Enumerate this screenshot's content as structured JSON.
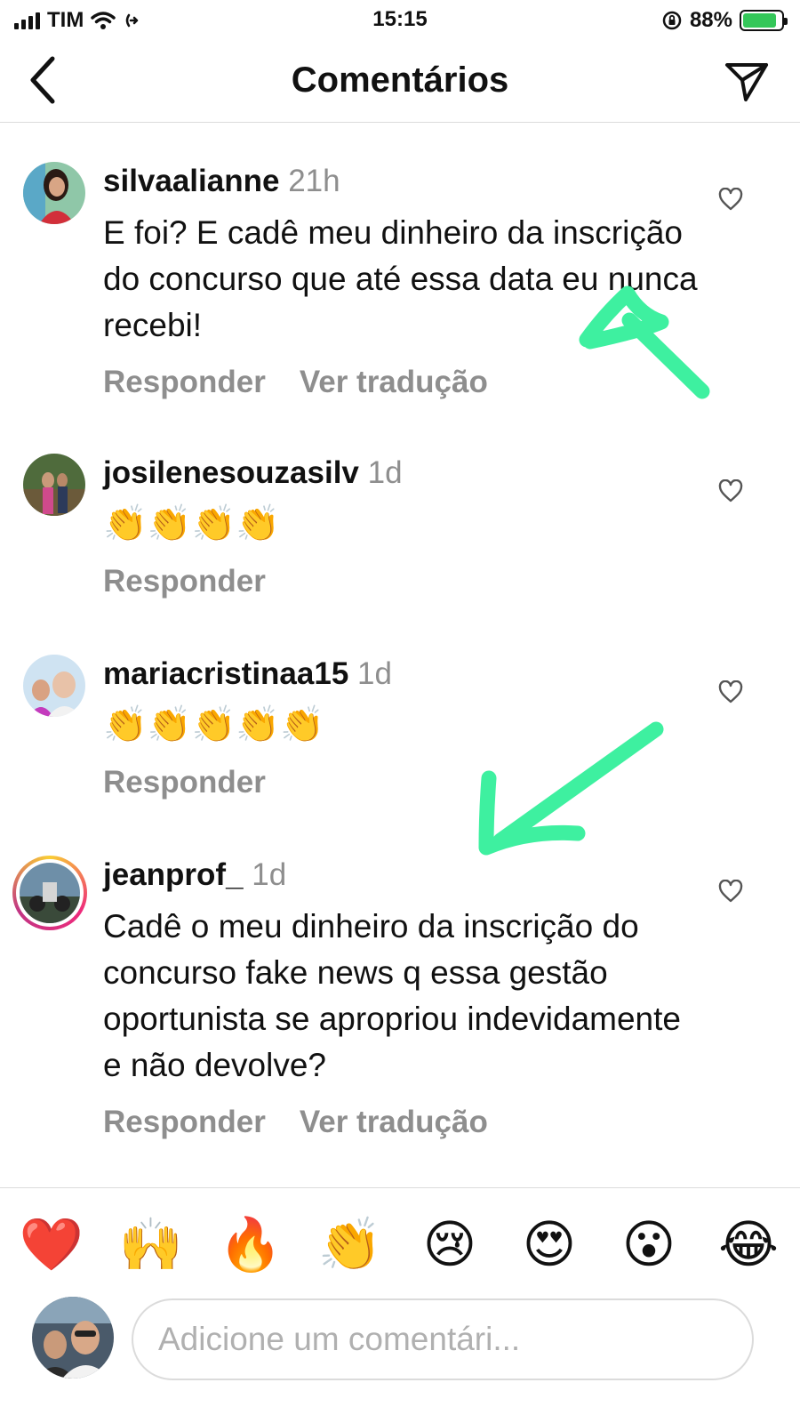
{
  "status": {
    "carrier": "TIM",
    "time": "15:15",
    "battery_pct": "88%",
    "battery_level": 0.88
  },
  "header": {
    "title": "Comentários",
    "back_icon": "chevron-left-icon",
    "share_icon": "paper-plane-icon"
  },
  "comments": [
    {
      "username": "silvaalianne",
      "time": "21h",
      "text": "E foi? E cadê meu dinheiro da inscrição do concurso que até essa data eu nunca recebi!",
      "reply": "Responder",
      "translate": "Ver tradução"
    },
    {
      "username": "josilenesouzasilv",
      "time": "1d",
      "text": "👏👏👏👏",
      "reply": "Responder"
    },
    {
      "username": "mariacristinaa15",
      "time": "1d",
      "text": "👏👏👏👏👏",
      "reply": "Responder"
    },
    {
      "username": "jeanprof_",
      "time": "1d",
      "text": "Cadê o meu dinheiro da inscrição do concurso fake news q essa gestão oportunista se apropriou indevidamente e não devolve?",
      "reply": "Responder",
      "translate": "Ver tradução"
    }
  ],
  "reactions": [
    "❤️",
    "🙌",
    "🔥",
    "👏",
    "😢",
    "😍",
    "😮",
    "😂"
  ],
  "composer": {
    "placeholder": "Adicione um comentári..."
  },
  "colors": {
    "annotation_arrow": "#3ef0a0",
    "muted_text": "#8e8e8e",
    "divider": "#dbdbdb"
  }
}
